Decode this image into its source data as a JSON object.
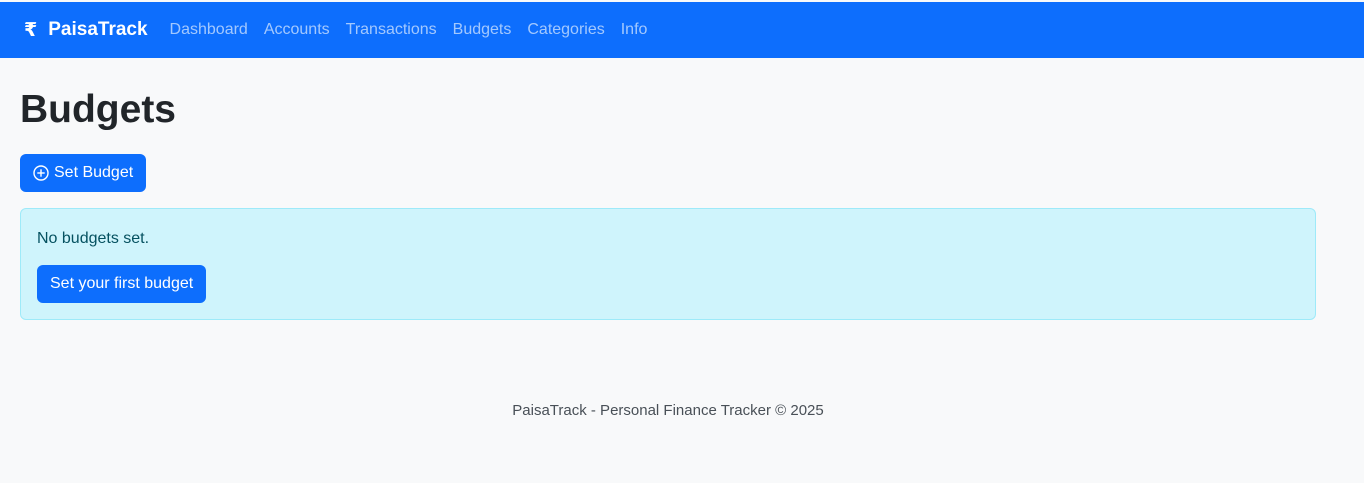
{
  "navbar": {
    "brand_icon": "₹",
    "brand_name": "PaisaTrack",
    "links": [
      {
        "label": "Dashboard"
      },
      {
        "label": "Accounts"
      },
      {
        "label": "Transactions"
      },
      {
        "label": "Budgets"
      },
      {
        "label": "Categories"
      },
      {
        "label": "Info"
      }
    ]
  },
  "main": {
    "title": "Budgets",
    "set_budget_label": "Set Budget",
    "set_budget_icon": "plus-circle-icon",
    "alert": {
      "message": "No budgets set.",
      "cta_label": "Set your first budget"
    }
  },
  "footer": {
    "text": "PaisaTrack - Personal Finance Tracker © 2025"
  },
  "colors": {
    "primary": "#0d6efd",
    "alert_bg": "#cff4fc",
    "alert_border": "#9eeaf9",
    "alert_text": "#055160",
    "page_bg": "#f8f9fa"
  }
}
